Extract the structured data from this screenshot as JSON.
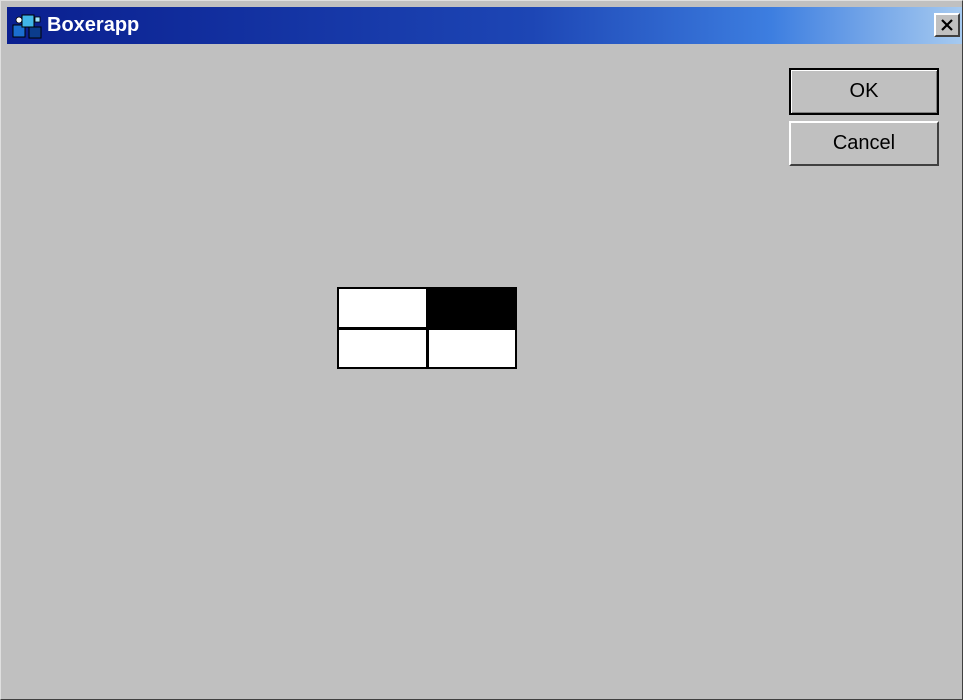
{
  "window": {
    "title": "Boxerapp",
    "close_glyph": "✕",
    "icon": "boxerapp-icon"
  },
  "buttons": {
    "ok_label": "OK",
    "cancel_label": "Cancel"
  },
  "grid": {
    "rows": 2,
    "cols": 2,
    "cells": [
      {
        "row": 0,
        "col": 0,
        "state": "empty",
        "color": "#ffffff"
      },
      {
        "row": 0,
        "col": 1,
        "state": "filled",
        "color": "#000000"
      },
      {
        "row": 1,
        "col": 0,
        "state": "empty",
        "color": "#ffffff"
      },
      {
        "row": 1,
        "col": 1,
        "state": "empty",
        "color": "#ffffff"
      }
    ]
  },
  "colors": {
    "titlebar_start": "#0a1f8f",
    "titlebar_end": "#a6caf0",
    "face": "#c0c0c0"
  }
}
